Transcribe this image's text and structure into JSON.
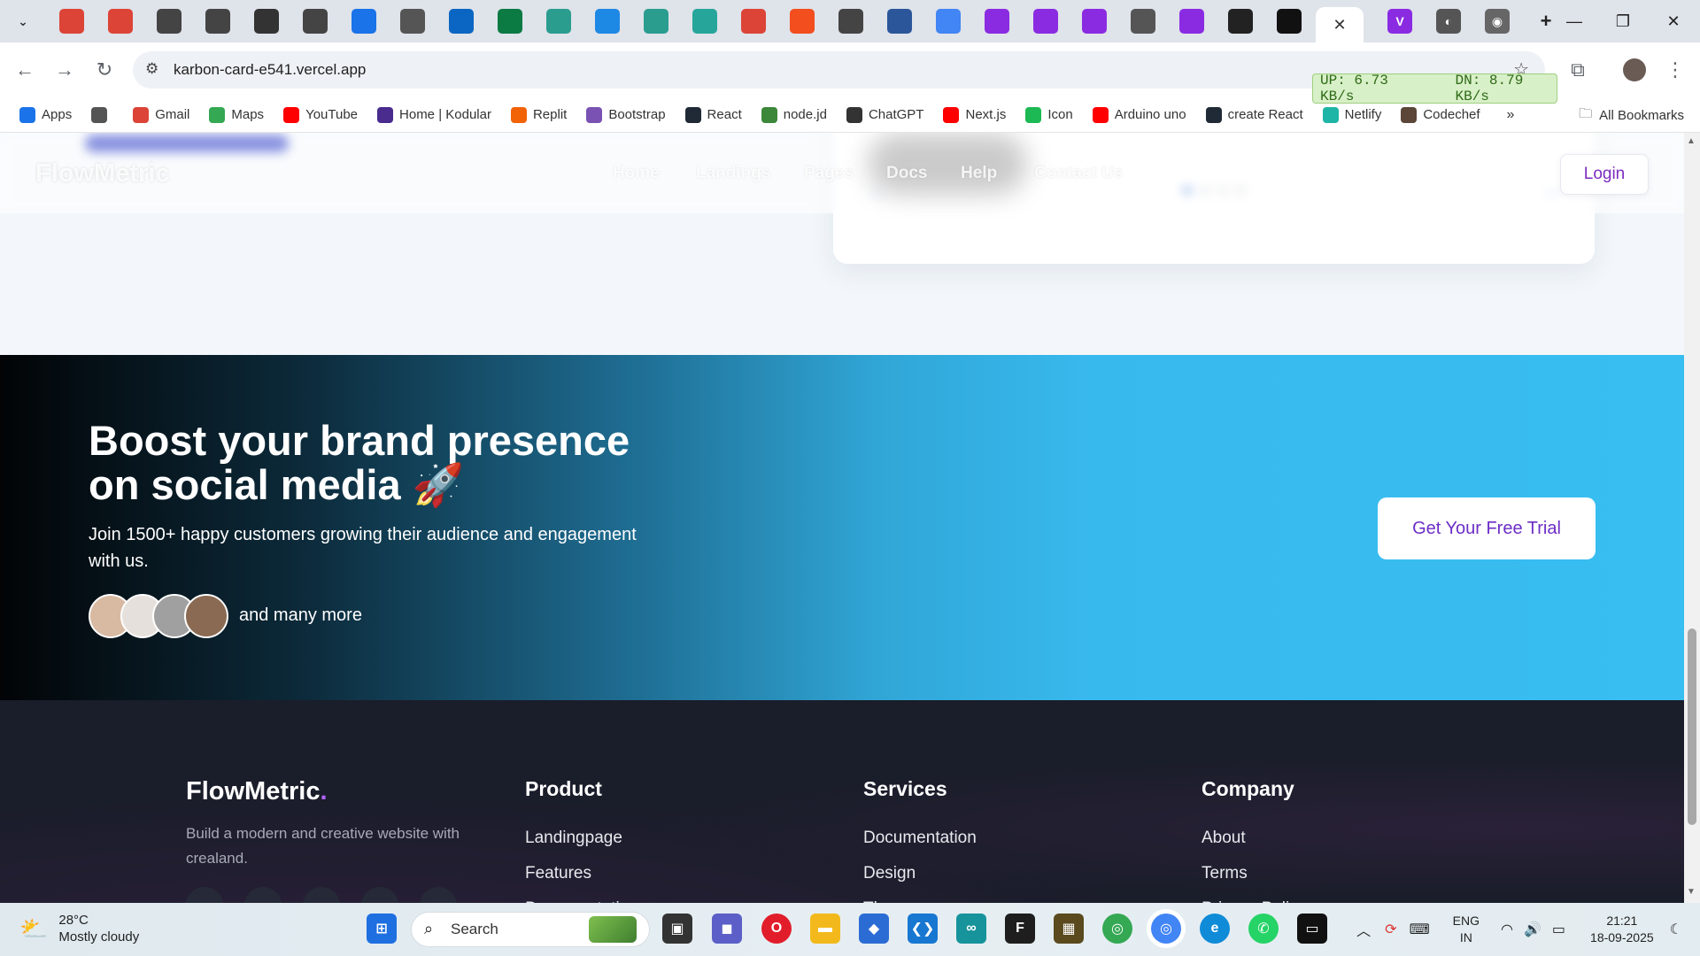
{
  "browser": {
    "url": "karbon-card-e541.vercel.app",
    "net_up": "UP: 6.73 KB/s",
    "net_down": "DN: 8.79 KB/s",
    "tab_colors": [
      "#db4437",
      "#db4437",
      "#444",
      "#444",
      "#333",
      "#444",
      "#1a73e8",
      "#555",
      "#0a66c2",
      "#0b7a43",
      "#2a9d8f",
      "#1e88e5",
      "#2a9d8f",
      "#26a69a",
      "#db4437",
      "#f24e1e",
      "#444",
      "#2b579a",
      "#4285f4",
      "#8a2be2",
      "#8a2be2",
      "#8a2be2",
      "#555",
      "#8a2be2",
      "#222",
      "#111"
    ],
    "bookmarks": [
      {
        "label": "Apps",
        "icon": "apps-grid-icon",
        "color": "#1a73e8"
      },
      {
        "label": "",
        "icon": "grid-icon",
        "color": "#555"
      },
      {
        "label": "Gmail",
        "icon": "gmail-icon",
        "color": "#db4437"
      },
      {
        "label": "Maps",
        "icon": "maps-icon",
        "color": "#34a853"
      },
      {
        "label": "YouTube",
        "icon": "youtube-icon",
        "color": "#ff0000"
      },
      {
        "label": "Home | Kodular",
        "icon": "kodular-icon",
        "color": "#4a2c8f"
      },
      {
        "label": "Replit",
        "icon": "replit-icon",
        "color": "#f26207"
      },
      {
        "label": "Bootstrap",
        "icon": "bootstrap-icon",
        "color": "#7952b3"
      },
      {
        "label": "React",
        "icon": "react-icon",
        "color": "#1f2a36"
      },
      {
        "label": "node.jd",
        "icon": "nodejs-icon",
        "color": "#3c873a"
      },
      {
        "label": "ChatGPT",
        "icon": "chatgpt-icon",
        "color": "#333"
      },
      {
        "label": "Next.js",
        "icon": "youtube-icon",
        "color": "#ff0000"
      },
      {
        "label": "Icon",
        "icon": "icon-app-icon",
        "color": "#1db954"
      },
      {
        "label": "Arduino uno",
        "icon": "youtube-icon",
        "color": "#ff0000"
      },
      {
        "label": "create React",
        "icon": "react-icon",
        "color": "#1f2a36"
      },
      {
        "label": "Netlify",
        "icon": "netlify-icon",
        "color": "#1fb5a6"
      },
      {
        "label": "Codechef",
        "icon": "codechef-icon",
        "color": "#5b4638"
      }
    ],
    "all_bookmarks": "All Bookmarks"
  },
  "site": {
    "brand": "FlowMetric",
    "nav": [
      "Home",
      "Landings",
      "Pages",
      "Docs",
      "Help",
      "Contact Us"
    ],
    "login": "Login",
    "carousel_prev": "←",
    "carousel_next": "→",
    "carousel_active_index": 0,
    "carousel_count": 4
  },
  "cta": {
    "title": "Boost your brand presence on social media 🚀",
    "subtitle": "Join 1500+ happy customers growing their audience and engagement with us.",
    "more": "and many more",
    "button": "Get Your Free Trial",
    "avatar_colors": [
      "#d8b9a2",
      "#e6e0dc",
      "#a0a0a0",
      "#8a6a52"
    ]
  },
  "footer": {
    "brand": "FlowMetric",
    "brand_dot": ".",
    "description": "Build a modern and creative website with crealand.",
    "columns": [
      {
        "title": "Product",
        "links": [
          "Landingpage",
          "Features",
          "Documentation"
        ]
      },
      {
        "title": "Services",
        "links": [
          "Documentation",
          "Design",
          "Themes"
        ]
      },
      {
        "title": "Company",
        "links": [
          "About",
          "Terms",
          "Privacy Policy"
        ]
      }
    ]
  },
  "taskbar": {
    "temperature": "28°C",
    "weather": "Mostly cloudy",
    "search": "Search",
    "lang_top": "ENG",
    "lang_bottom": "IN",
    "time": "21:21",
    "date": "18-09-2025"
  }
}
